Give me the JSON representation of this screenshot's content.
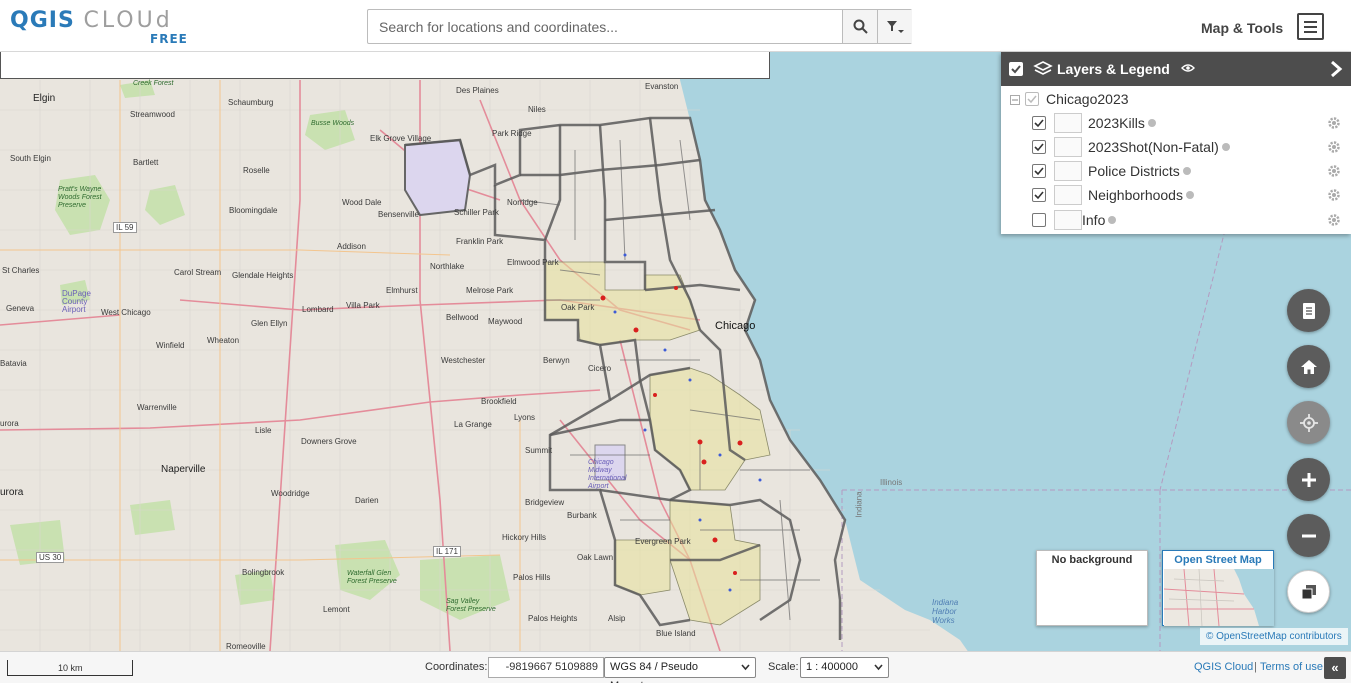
{
  "app": {
    "logo_main_q": "QGIS",
    "logo_main_c": "CLOUd",
    "logo_sub": "FREE"
  },
  "search": {
    "placeholder": "Search for locations and coordinates...",
    "search_icon": "magnifier-icon",
    "filter_icon": "filter-dropdown-icon"
  },
  "header": {
    "map_tools_label": "Map & Tools",
    "menu_icon": "hamburger-menu-icon"
  },
  "legend": {
    "title": "Layers & Legend",
    "group": "Chicago2023",
    "layers": [
      {
        "label": "2023Kills",
        "checked": true
      },
      {
        "label": "2023Shot(Non-Fatal)",
        "checked": true
      },
      {
        "label": "Police Districts",
        "checked": true
      },
      {
        "label": "Neighborhoods",
        "checked": true
      },
      {
        "label": "Info",
        "checked": false
      }
    ]
  },
  "map_labels": {
    "chicago": "Chicago",
    "elgin": "Elgin",
    "schaumburg": "Schaumburg",
    "streamwood": "Streamwood",
    "des_plaines": "Des Plaines",
    "niles": "Niles",
    "evanston": "Evanston",
    "park_ridge": "Park Ridge",
    "elk_grove": "Elk Grove Village",
    "bartlett": "Bartlett",
    "roselle": "Roselle",
    "south_elgin": "South Elgin",
    "norridge": "Norridge",
    "wood_dale": "Wood Dale",
    "bensenville": "Bensenville",
    "schiller_park": "Schiller Park",
    "bloomingdale": "Bloomingdale",
    "franklin_park": "Franklin Park",
    "addison": "Addison",
    "elmwood_park": "Elmwood Park",
    "northlake": "Northlake",
    "carol_stream": "Carol Stream",
    "glendale_heights": "Glendale Heights",
    "st_charles": "St Charles",
    "elmhurst": "Elmhurst",
    "melrose_park": "Melrose Park",
    "oak_park": "Oak Park",
    "villa_park": "Villa Park",
    "lombard": "Lombard",
    "bellwood": "Bellwood",
    "maywood": "Maywood",
    "geneva": "Geneva",
    "west_chicago": "West Chicago",
    "glen_ellyn": "Glen Ellyn",
    "winfield": "Winfield",
    "wheaton": "Wheaton",
    "westchester": "Westchester",
    "berwyn": "Berwyn",
    "cicero": "Cicero",
    "batavia": "Batavia",
    "warrenville": "Warrenville",
    "brookfield": "Brookfield",
    "lyons": "Lyons",
    "aurora_w": "urora",
    "lisle": "Lisle",
    "la_grange": "La Grange",
    "downers_grove": "Downers Grove",
    "summit": "Summit",
    "naperville": "Naperville",
    "aurora": "urora",
    "woodridge": "Woodridge",
    "darien": "Darien",
    "bridgeview": "Bridgeview",
    "burbank": "Burbank",
    "hickory_hills": "Hickory Hills",
    "evergreen_park": "Evergreen Park",
    "oak_lawn": "Oak Lawn",
    "bolingbrook": "Bolingbrook",
    "palos_hills": "Palos Hills",
    "lemont": "Lemont",
    "palos_heights": "Palos Heights",
    "alsip": "Alsip",
    "blue_island": "Blue Island",
    "romeoville": "Romeoville",
    "airport": "Chicago Midway International Airport",
    "illinois": "Illinois",
    "indiana": "Indiana",
    "indiana_harbor": "Indiana Harbor Works",
    "creek_forest": "Creek Forest",
    "busse_woods": "Busse Woods",
    "pratts_wayne": "Pratt's Wayne Woods Forest Preserve",
    "dupage_airport": "DuPage County Airport",
    "waterfall_glen": "Waterfall Glen Forest Preserve",
    "sag_valley": "Sag Valley Forest Preserve",
    "il59": "IL 59",
    "il171": "IL 171",
    "us30": "US 30"
  },
  "background": {
    "none_label": "No background",
    "osm_label": "Open Street Map",
    "attribution": "© OpenStreetMap contributors"
  },
  "footer": {
    "scale_bar": "10 km",
    "coordinates_label": "Coordinates:",
    "coordinates_value": "-9819667 5109889",
    "crs": "WGS 84 / Pseudo Mercator",
    "scale_label": "Scale:",
    "scale_value": "1 : 400000",
    "qgis_cloud_link": "QGIS Cloud",
    "separator": "|",
    "terms_link": "Terms of use",
    "collapse": "«"
  },
  "colors": {
    "lake": "#aad3df",
    "land": "#eae6df",
    "park": "#c8e2b0",
    "road_major": "#e39aa0",
    "road_motorway": "#e892a2",
    "district_border": "#555555",
    "neighborhood_fill": "#e8e29a",
    "kill_dot": "#d9201e",
    "shot_dot": "#3d5bd6",
    "accent": "#2a7ab8"
  }
}
